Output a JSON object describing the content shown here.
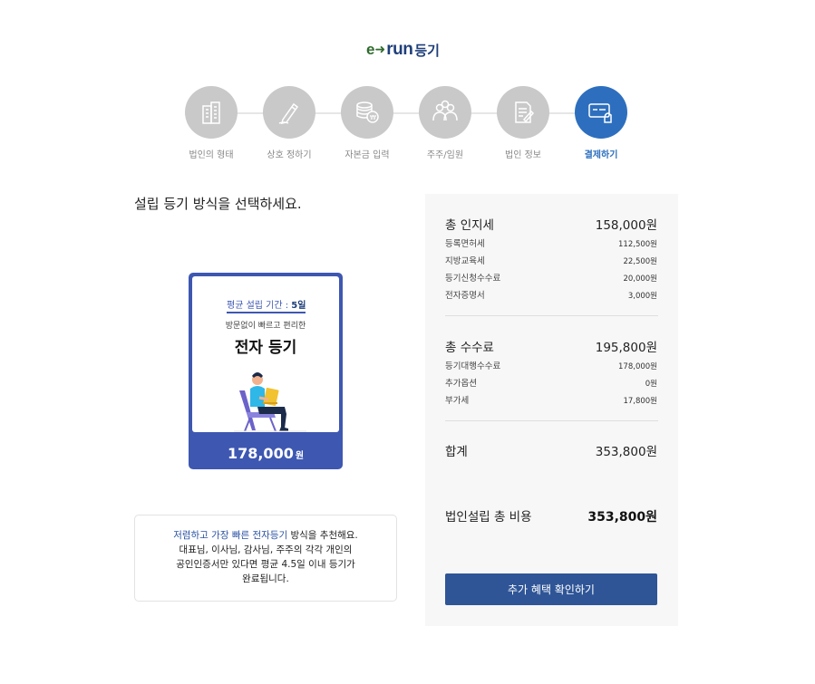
{
  "logo": {
    "e": "e",
    "run": "run",
    "reg": "등기"
  },
  "steps": [
    {
      "label": "법인의 형태",
      "icon": "building-icon",
      "active": false
    },
    {
      "label": "상호 정하기",
      "icon": "pen-icon",
      "active": false
    },
    {
      "label": "자본금 입력",
      "icon": "coins-icon",
      "active": false
    },
    {
      "label": "주주/임원",
      "icon": "people-icon",
      "active": false
    },
    {
      "label": "법인 정보",
      "icon": "document-icon",
      "active": false
    },
    {
      "label": "결제하기",
      "icon": "card-payment-icon",
      "active": true
    }
  ],
  "page_title": "설립 등기 방식을 선택하세요.",
  "card": {
    "period_prefix": "평균 설립 기간 : ",
    "period_value": "5일",
    "subtitle": "방문없이 빠르고 편리한",
    "title": "전자 등기",
    "price": "178,000",
    "price_unit": "원"
  },
  "recommend": {
    "highlight": "저렴하고 가장 빠른 전자등기",
    "line1_rest": " 방식을 추천해요.",
    "line2": "대표님, 이사님, 감사님, 주주의 각각 개인의",
    "line3": "공인인증서만 있다면 평균 4.5일 이내 등기가",
    "line4": "완료됩니다."
  },
  "summary": {
    "stamp_total": {
      "label": "총 인지세",
      "value": "158,000원"
    },
    "stamp_items": [
      {
        "label": "등록면허세",
        "value": "112,500원"
      },
      {
        "label": "지방교육세",
        "value": "22,500원"
      },
      {
        "label": "등기신청수수료",
        "value": "20,000원"
      },
      {
        "label": "전자증명서",
        "value": "3,000원"
      }
    ],
    "fee_total": {
      "label": "총 수수료",
      "value": "195,800원"
    },
    "fee_items": [
      {
        "label": "등기대행수수료",
        "value": "178,000원"
      },
      {
        "label": "추가옵션",
        "value": "0원"
      },
      {
        "label": "부가세",
        "value": "17,800원"
      }
    ],
    "sum": {
      "label": "합계",
      "value": "353,800원"
    },
    "grand_total": {
      "label": "법인설립 총 비용",
      "value": "353,800원"
    },
    "button_label": "추가 혜택 확인하기"
  },
  "colors": {
    "primary": "#2f5597",
    "active_step": "#2d6fbe",
    "card": "#3e57b1",
    "inactive_step": "#c9c9c9"
  }
}
